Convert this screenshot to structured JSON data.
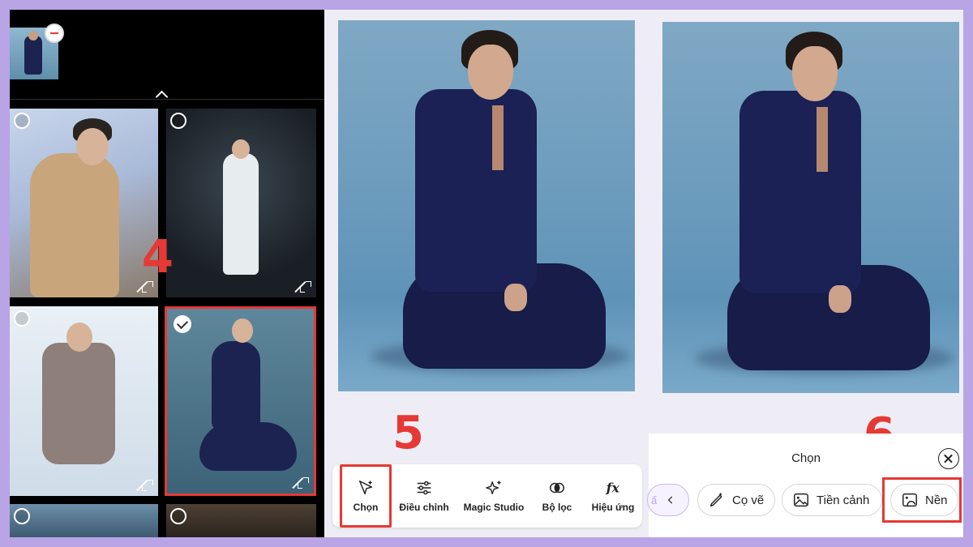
{
  "steps": {
    "step4": "4",
    "step5": "5",
    "step6": "6"
  },
  "toolbar": {
    "items": [
      {
        "label": "Chọn",
        "icon": "magic-select-icon"
      },
      {
        "label": "Điều chỉnh",
        "icon": "sliders-icon"
      },
      {
        "label": "Magic Studio",
        "icon": "sparkles-icon"
      },
      {
        "label": "Bộ lọc",
        "icon": "filter-circles-icon"
      },
      {
        "label": "Hiệu ứng",
        "icon": "fx-icon"
      }
    ]
  },
  "sheet": {
    "title": "Chọn",
    "back_partial": "ấ",
    "chips": [
      {
        "label": "Cọ vẽ",
        "icon": "brush-icon"
      },
      {
        "label": "Tiền cảnh",
        "icon": "foreground-image-icon"
      },
      {
        "label": "Nền",
        "icon": "background-image-icon"
      }
    ]
  },
  "colors": {
    "frame_bg": "#b9a4e6",
    "highlight": "#e53935",
    "step_number": "#e53935"
  }
}
